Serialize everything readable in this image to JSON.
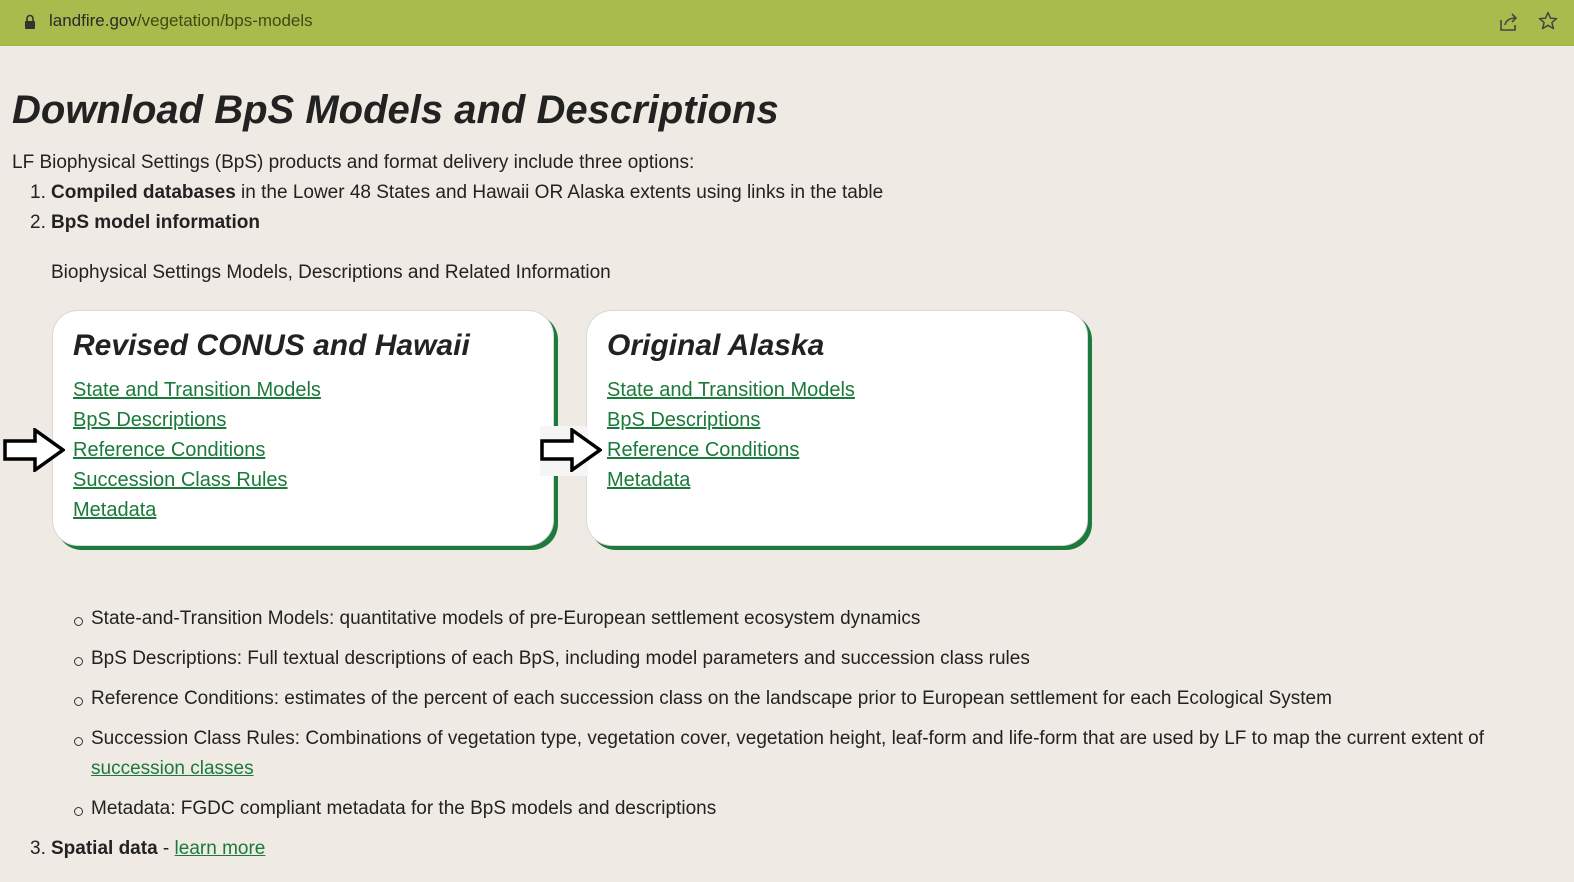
{
  "browser": {
    "url_host": "landfire.gov",
    "url_path": "/vegetation/bps-models"
  },
  "page": {
    "title": "Download BpS Models and Descriptions",
    "intro": "LF Biophysical Settings (BpS) products and format delivery include three options:",
    "list": [
      {
        "num": "1.",
        "bold": "Compiled databases",
        "rest": " in the Lower 48 States and Hawaii OR Alaska extents using links in the table"
      },
      {
        "num": "2.",
        "bold": "BpS model information",
        "rest": ""
      },
      {
        "num": "3.",
        "bold": "Spatial data",
        "rest": " - ",
        "link": "learn more"
      }
    ],
    "cards_caption": "Biophysical Settings Models, Descriptions and Related Information"
  },
  "cards": [
    {
      "title": "Revised CONUS and Hawaii",
      "links": [
        "State and Transition Models",
        "BpS Descriptions",
        "Reference Conditions",
        "Succession Class Rules",
        "Metadata"
      ]
    },
    {
      "title": "Original Alaska",
      "links": [
        "State and Transition Models",
        "BpS Descriptions",
        "Reference Conditions",
        "Metadata"
      ]
    }
  ],
  "definitions": [
    {
      "text": "State-and-Transition Models: quantitative models of pre-European settlement ecosystem dynamics"
    },
    {
      "text": "BpS Descriptions: Full textual descriptions of each BpS, including model parameters and succession class rules"
    },
    {
      "text": "Reference Conditions: estimates of the percent of each succession class on the landscape prior to European settlement for each Ecological System"
    },
    {
      "text": "Succession Class Rules: Combinations of vegetation type, vegetation cover, vegetation height, leaf-form and life-form that are used by LF to map the current extent of",
      "link": "succession classes"
    },
    {
      "text": "Metadata: FGDC compliant metadata for the BpS models and descriptions"
    }
  ],
  "colors": {
    "address_bar": "#a9bb4d",
    "link": "#1a7a3a",
    "card_shadow": "#1e7a3c",
    "page_bg": "#efebe4"
  },
  "icons": [
    "lock-icon",
    "share-icon",
    "star-icon",
    "arrow-right-icon"
  ]
}
